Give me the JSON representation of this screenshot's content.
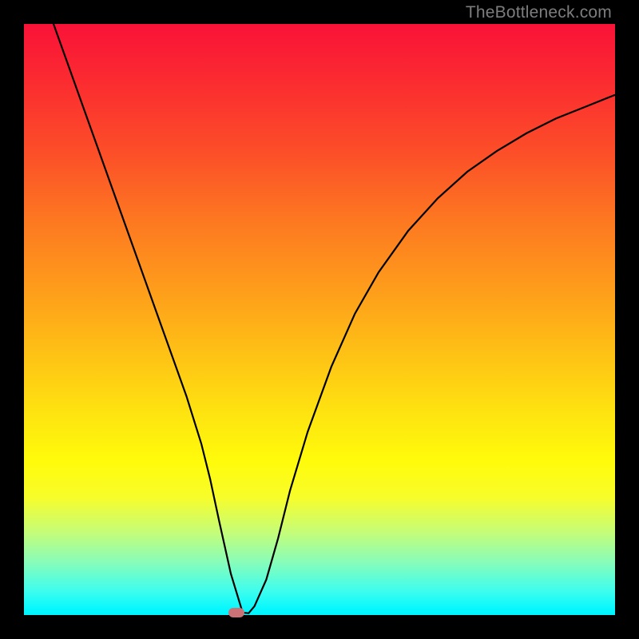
{
  "watermark": "TheBottleneck.com",
  "colors": {
    "frame_bg": "#000000",
    "curve": "#000000",
    "marker": "#cb7277",
    "watermark_text": "#7d7d7d"
  },
  "chart_data": {
    "type": "line",
    "title": "",
    "xlabel": "",
    "ylabel": "",
    "xlim": [
      0,
      100
    ],
    "ylim": [
      0,
      100
    ],
    "series": [
      {
        "name": "curve",
        "x": [
          5,
          7.5,
          10,
          12.5,
          15,
          17.5,
          20,
          22.5,
          25,
          27.5,
          30,
          31.5,
          33,
          35,
          37,
          38,
          39,
          41,
          43,
          45,
          48,
          52,
          56,
          60,
          65,
          70,
          75,
          80,
          85,
          90,
          95,
          100
        ],
        "y": [
          100,
          93,
          86,
          79,
          72,
          65,
          58,
          51,
          44,
          37,
          29,
          23,
          16,
          7,
          0.4,
          0.3,
          1.5,
          6,
          13,
          21,
          31,
          42,
          51,
          58,
          65,
          70.5,
          75,
          78.5,
          81.5,
          84,
          86,
          88
        ]
      }
    ],
    "annotations": [
      {
        "name": "min-marker",
        "x": 36,
        "y": 0.4
      }
    ],
    "background_gradient": {
      "direction": "top-to-bottom",
      "stops": [
        {
          "pos": 0,
          "color": "#f91238"
        },
        {
          "pos": 10,
          "color": "#fb2c30"
        },
        {
          "pos": 22,
          "color": "#fc4f28"
        },
        {
          "pos": 33,
          "color": "#fd7721"
        },
        {
          "pos": 45,
          "color": "#fe9d1b"
        },
        {
          "pos": 56,
          "color": "#fec215"
        },
        {
          "pos": 66,
          "color": "#fee410"
        },
        {
          "pos": 74,
          "color": "#fffb0b"
        },
        {
          "pos": 80,
          "color": "#f8fd2a"
        },
        {
          "pos": 86,
          "color": "#c5fd78"
        },
        {
          "pos": 91,
          "color": "#88fdb8"
        },
        {
          "pos": 96,
          "color": "#3dfdee"
        },
        {
          "pos": 99,
          "color": "#06f8fe"
        },
        {
          "pos": 100,
          "color": "#00f4ff"
        }
      ]
    }
  }
}
